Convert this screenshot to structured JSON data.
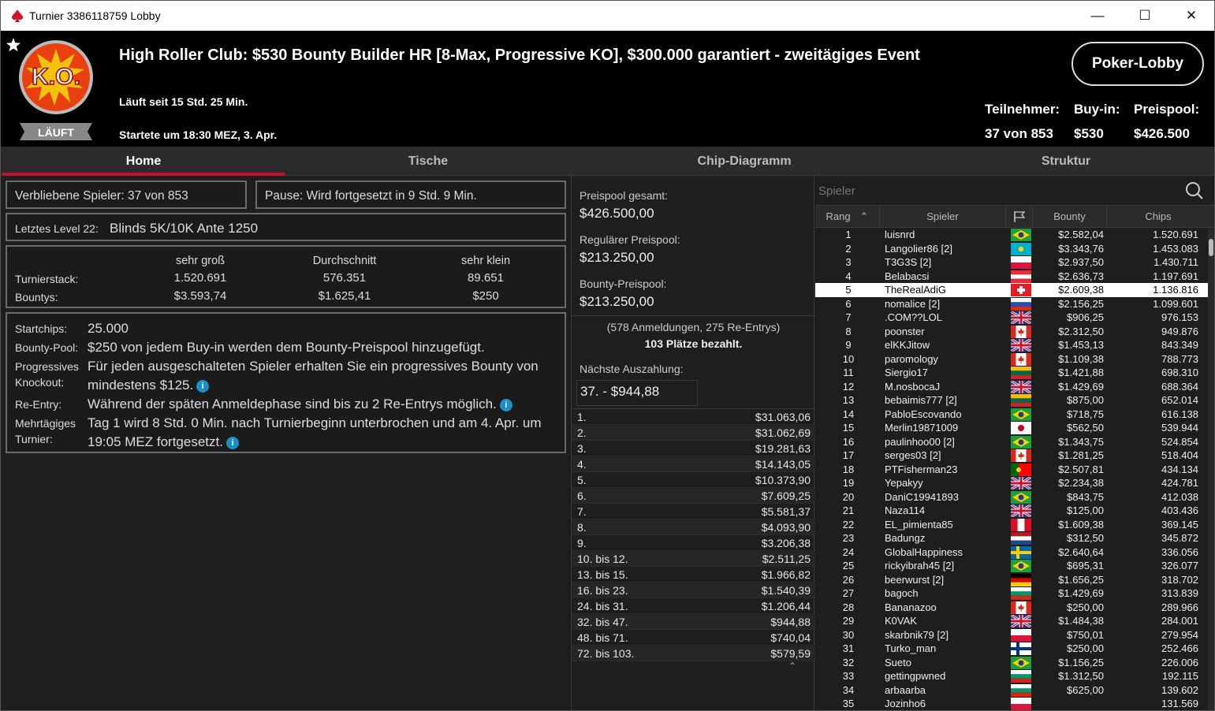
{
  "window": {
    "title": "Turnier 3386118759 Lobby",
    "controls": [
      "—",
      "☐",
      "✕"
    ]
  },
  "header": {
    "title": "High Roller Club: $530 Bounty Builder HR [8-Max, Progressive KO], $300.000 garantiert - zweitägiges Event",
    "running": "Läuft seit 15 Std. 25 Min.",
    "started": "Startete um 18:30 MEZ, 3. Apr.",
    "status_badge": "LÄUFT",
    "logo_text": "K.O.",
    "lobby_button": "Poker-Lobby",
    "stats": {
      "entrants_label": "Teilnehmer:",
      "entrants_value": "37 von 853",
      "buyin_label": "Buy-in:",
      "buyin_value": "$530",
      "prizepool_label": "Preispool:",
      "prizepool_value": "$426.500"
    }
  },
  "tabs": [
    {
      "label": "Home",
      "active": true
    },
    {
      "label": "Tische"
    },
    {
      "label": "Chip-Diagramm"
    },
    {
      "label": "Struktur"
    }
  ],
  "home": {
    "remaining": "Verbliebene Spieler: 37 von 853",
    "pause": "Pause: Wird fortgesetzt in 9 Std. 9 Min.",
    "level_label": "Letztes Level 22:",
    "level_value": "Blinds 5K/10K Ante 1250",
    "stack_table": {
      "headers": [
        "sehr groß",
        "Durchschnitt",
        "sehr klein"
      ],
      "rows": [
        {
          "label": "Turnierstack:",
          "values": [
            "1.520.691",
            "576.351",
            "89.651"
          ]
        },
        {
          "label": "Bountys:",
          "values": [
            "$3.593,74",
            "$1.625,41",
            "$250"
          ]
        }
      ]
    },
    "info": {
      "startchips_label": "Startchips:",
      "startchips_value": "25.000",
      "bountypool_label": "Bounty-Pool:",
      "bountypool_value": "$250 von jedem Buy-in werden dem Bounty-Preispool hinzugefügt.",
      "pko_label1": "Progressives",
      "pko_label2": "Knockout:",
      "pko_line1": "Für jeden ausgeschalteten Spieler erhalten Sie ein progressives Bounty von",
      "pko_line2": "mindestens $125.",
      "reentry_label": "Re-Entry:",
      "reentry_value": "Während der späten Anmeldephase sind bis zu 2 Re-Entrys möglich.",
      "multi_label1": "Mehrtägiges",
      "multi_label2": "Turnier:",
      "multi_line1": "Tag 1 wird 8 Std. 0 Min. nach Turnierbeginn unterbrochen und am 4. Apr. um",
      "multi_line2": "19:05 MEZ fortgesetzt."
    }
  },
  "prizes": {
    "total_label": "Preispool gesamt:",
    "total_value": "$426.500,00",
    "regular_label": "Regulärer Preispool:",
    "regular_value": "$213.250,00",
    "bounty_label": "Bounty-Preispool:",
    "bounty_value": "$213.250,00",
    "registrations": "(578 Anmeldungen, 275 Re-Entrys)",
    "paid": "103 Plätze bezahlt.",
    "next_label": "Nächste Auszahlung:",
    "next_value": "37. - $944,88",
    "payouts": [
      {
        "place": "1.",
        "amount": "$31.063,06"
      },
      {
        "place": "2.",
        "amount": "$31.062,69"
      },
      {
        "place": "3.",
        "amount": "$19.281,63"
      },
      {
        "place": "4.",
        "amount": "$14.143,05"
      },
      {
        "place": "5.",
        "amount": "$10.373,90"
      },
      {
        "place": "6.",
        "amount": "$7.609,25"
      },
      {
        "place": "7.",
        "amount": "$5.581,37"
      },
      {
        "place": "8.",
        "amount": "$4.093,90"
      },
      {
        "place": "9.",
        "amount": "$3.206,38"
      },
      {
        "place": "10. bis 12.",
        "amount": "$2.511,25"
      },
      {
        "place": "13. bis 15.",
        "amount": "$1.966,82"
      },
      {
        "place": "16. bis 23.",
        "amount": "$1.540,39"
      },
      {
        "place": "24. bis 31.",
        "amount": "$1.206,44"
      },
      {
        "place": "32. bis 47.",
        "amount": "$944,88"
      },
      {
        "place": "48. bis 71.",
        "amount": "$740,04"
      },
      {
        "place": "72. bis 103.",
        "amount": "$579,59"
      }
    ]
  },
  "players": {
    "search_placeholder": "Spieler",
    "headers": {
      "rank": "Rang",
      "player": "Spieler",
      "bounty": "Bounty",
      "chips": "Chips"
    },
    "selected_rank": 5,
    "rows": [
      {
        "rank": "1",
        "name": "luisnrd",
        "flag": "br",
        "bounty": "$2.582,04",
        "chips": "1.520.691"
      },
      {
        "rank": "2",
        "name": "Langolier86 [2]",
        "flag": "kz",
        "bounty": "$3.343,76",
        "chips": "1.453.083"
      },
      {
        "rank": "3",
        "name": "T3G3S [2]",
        "flag": "pl",
        "bounty": "$2.937,50",
        "chips": "1.430.711"
      },
      {
        "rank": "4",
        "name": "Belabacsi",
        "flag": "at",
        "bounty": "$2.636,73",
        "chips": "1.197.691"
      },
      {
        "rank": "5",
        "name": "TheRealAdiG",
        "flag": "ch",
        "bounty": "$2.609,38",
        "chips": "1.136.816"
      },
      {
        "rank": "6",
        "name": "nomalice [2]",
        "flag": "ru",
        "bounty": "$2.156,25",
        "chips": "1.099.601"
      },
      {
        "rank": "7",
        "name": ".COM??LOL",
        "flag": "gb",
        "bounty": "$906,25",
        "chips": "976.153"
      },
      {
        "rank": "8",
        "name": "poonster",
        "flag": "ca",
        "bounty": "$2.312,50",
        "chips": "949.876"
      },
      {
        "rank": "9",
        "name": "elKKJitow",
        "flag": "gb",
        "bounty": "$1.453,13",
        "chips": "843.349"
      },
      {
        "rank": "10",
        "name": "paromology",
        "flag": "ca",
        "bounty": "$1.109,38",
        "chips": "788.773"
      },
      {
        "rank": "11",
        "name": "Siergio17",
        "flag": "lt",
        "bounty": "$1.421,88",
        "chips": "698.310"
      },
      {
        "rank": "12",
        "name": "M.nosbocaJ",
        "flag": "gb",
        "bounty": "$1.429,69",
        "chips": "688.364"
      },
      {
        "rank": "13",
        "name": "bebaimis777 [2]",
        "flag": "lt",
        "bounty": "$875,00",
        "chips": "652.014"
      },
      {
        "rank": "14",
        "name": "PabloEscovando",
        "flag": "br",
        "bounty": "$718,75",
        "chips": "616.138"
      },
      {
        "rank": "15",
        "name": "Merlin19871009",
        "flag": "jp",
        "bounty": "$562,50",
        "chips": "539.944"
      },
      {
        "rank": "16",
        "name": "paulinhoo00 [2]",
        "flag": "br",
        "bounty": "$1.343,75",
        "chips": "524.854"
      },
      {
        "rank": "17",
        "name": "serges03 [2]",
        "flag": "ca",
        "bounty": "$1.281,25",
        "chips": "518.404"
      },
      {
        "rank": "18",
        "name": "PTFisherman23",
        "flag": "pt",
        "bounty": "$2.507,81",
        "chips": "434.134"
      },
      {
        "rank": "19",
        "name": "Yepakyy",
        "flag": "gb",
        "bounty": "$2.234,38",
        "chips": "424.781"
      },
      {
        "rank": "20",
        "name": "DaniC19941893",
        "flag": "br",
        "bounty": "$843,75",
        "chips": "412.038"
      },
      {
        "rank": "21",
        "name": "Naza114",
        "flag": "gb",
        "bounty": "$125,00",
        "chips": "403.436"
      },
      {
        "rank": "22",
        "name": "EL_pimienta85",
        "flag": "pe",
        "bounty": "$1.609,38",
        "chips": "369.145"
      },
      {
        "rank": "23",
        "name": "Badungz",
        "flag": "nl",
        "bounty": "$312,50",
        "chips": "345.872"
      },
      {
        "rank": "24",
        "name": "GlobalHappiness",
        "flag": "se",
        "bounty": "$2.640,64",
        "chips": "336.056"
      },
      {
        "rank": "25",
        "name": "rickyibrah45 [2]",
        "flag": "br",
        "bounty": "$695,31",
        "chips": "326.077"
      },
      {
        "rank": "26",
        "name": "beerwurst [2]",
        "flag": "de",
        "bounty": "$1.656,25",
        "chips": "318.702"
      },
      {
        "rank": "27",
        "name": "bagoch",
        "flag": "bg",
        "bounty": "$1.429,69",
        "chips": "313.839"
      },
      {
        "rank": "28",
        "name": "Bananazoo",
        "flag": "ca",
        "bounty": "$250,00",
        "chips": "289.966"
      },
      {
        "rank": "29",
        "name": "K0VAK",
        "flag": "gb",
        "bounty": "$1.484,38",
        "chips": "284.001"
      },
      {
        "rank": "30",
        "name": "skarbnik79 [2]",
        "flag": "pl",
        "bounty": "$750,01",
        "chips": "279.954"
      },
      {
        "rank": "31",
        "name": "Turko_man",
        "flag": "fi",
        "bounty": "$250,00",
        "chips": "252.466"
      },
      {
        "rank": "32",
        "name": "Sueto",
        "flag": "br",
        "bounty": "$1.156,25",
        "chips": "226.006"
      },
      {
        "rank": "33",
        "name": "gettingpwned",
        "flag": "bg",
        "bounty": "$1.312,50",
        "chips": "192.115"
      },
      {
        "rank": "34",
        "name": "arbaarba",
        "flag": "bg",
        "bounty": "$625,00",
        "chips": "139.602"
      },
      {
        "rank": "35",
        "name": "Jozinho6",
        "flag": "pl",
        "bounty": "",
        "chips": "131.569"
      }
    ]
  },
  "colors": {
    "accent": "#c8102e",
    "header_bg": "#000000",
    "panel_bg": "#1e1e1e",
    "info_icon": "#1a8fc8"
  }
}
